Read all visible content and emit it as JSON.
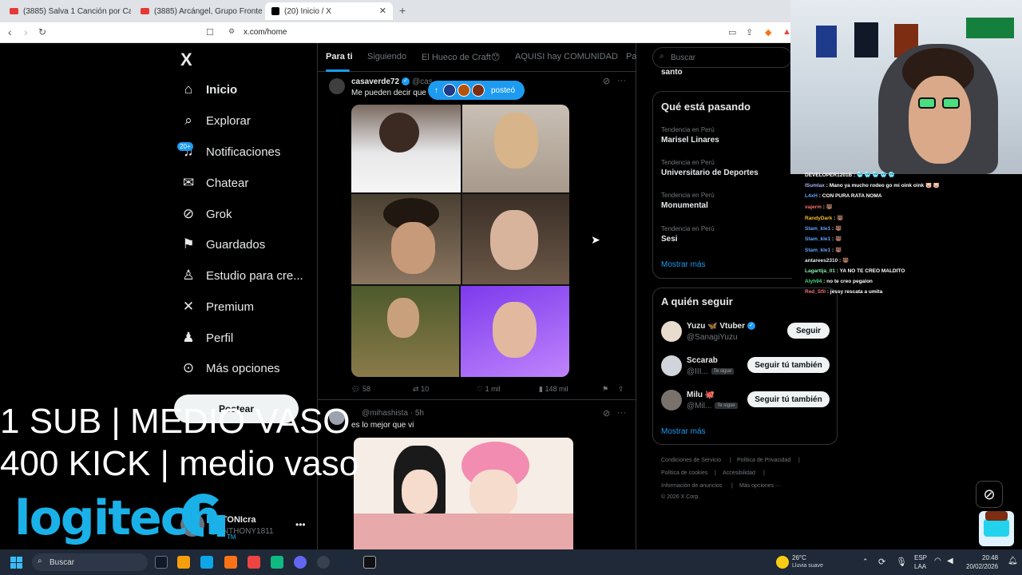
{
  "browser": {
    "tabs": [
      {
        "title": "(3885) Salva 1 Canción por Cada Cat..."
      },
      {
        "title": "(3885) Arcángel, Grupo Frontera"
      },
      {
        "title": "(20) Inicio / X"
      }
    ],
    "url": "x.com/home"
  },
  "sidebar": {
    "logo": "X",
    "items": [
      {
        "label": "Inicio",
        "icon": "home-icon"
      },
      {
        "label": "Explorar",
        "icon": "search-icon"
      },
      {
        "label": "Notificaciones",
        "icon": "bell-icon"
      },
      {
        "label": "Chatear",
        "icon": "mail-icon"
      },
      {
        "label": "Grok",
        "icon": "grok-icon"
      },
      {
        "label": "Guardados",
        "icon": "bookmark-icon"
      },
      {
        "label": "Estudio para cre...",
        "icon": "studio-icon"
      },
      {
        "label": "Premium",
        "icon": "x-premium-icon"
      },
      {
        "label": "Perfil",
        "icon": "person-icon"
      },
      {
        "label": "Más opciones",
        "icon": "more-circle-icon"
      }
    ],
    "notif_badge": "20+",
    "post_label": "Postear",
    "account": {
      "name": "ANTONIcra",
      "handle": "@ANTHONY1811"
    }
  },
  "overlay": {
    "line1": "1 SUB | MEDIO VASO",
    "line2": "400 KICK | medio vaso",
    "logi": "logitech",
    "tm": "TM"
  },
  "feed": {
    "tabs": [
      "Para ti",
      "Siguiendo",
      "El Hueco de Craft😯",
      "AQUISI hay COMUNIDAD",
      "Pa"
    ],
    "posted_pill": "posteó",
    "tweet1": {
      "name": "casaverde72",
      "handle": "@cas",
      "text": "Me pueden decir que",
      "replies": "58",
      "retweets": "10",
      "likes": "1 mil",
      "views": "148 mil"
    },
    "tweet2": {
      "handle": "@mihashista · 5h",
      "text": "es lo mejor que vi"
    }
  },
  "right": {
    "search_placeholder": "Buscar",
    "top_partial": "santo",
    "trends_title": "Qué está pasando",
    "trends": [
      {
        "context": "Tendencia en Perú",
        "name": "Marisel Linares"
      },
      {
        "context": "Tendencia en Perú",
        "name": "Universitario de Deportes"
      },
      {
        "context": "Tendencia en Perú",
        "name": "Monumental"
      },
      {
        "context": "Tendencia en Perú",
        "name": "Sesi"
      }
    ],
    "show_more": "Mostrar más",
    "follow_title": "A quién seguir",
    "follows": [
      {
        "name": "Yuzu 🦋 Vtuber",
        "handle": "@SanagiYuzu",
        "follows_you": "",
        "button": "Seguir"
      },
      {
        "name": "Sccarab",
        "handle": "@III...",
        "follows_you": "Te sigue",
        "button": "Seguir tú también"
      },
      {
        "name": "Milu 🐙",
        "handle": "@Mil...",
        "follows_you": "Te sigue",
        "button": "Seguir tú también"
      }
    ],
    "follow_more": "Mostrar más",
    "footer": [
      "Condiciones de Servicio",
      "|",
      "Política de Privacidad",
      "|",
      "Política de cookies",
      "|",
      "Accesibilidad",
      "|",
      "Información de anuncios",
      "|",
      "Más opciones ···",
      "© 2026 X Corp."
    ]
  },
  "chat": [
    {
      "user": "DEVELOPER1201B",
      "msg": ": 🥶 🥶 🥶 🥶 🥶",
      "color": "#ffffff"
    },
    {
      "user": "ISumlax",
      "msg": ": Mano ya mucho rodeo go mi oink oink 🐷 🐷",
      "color": "#a5b4fc"
    },
    {
      "user": "L4xH",
      "msg": ": CON PURA RATA NOMA",
      "color": "#60a5fa"
    },
    {
      "user": "vajerm",
      "msg": ": 🐻",
      "color": "#f87171"
    },
    {
      "user": "RandyDark",
      "msg": ": 🐻",
      "color": "#fbbf24"
    },
    {
      "user": "Stam_kle1",
      "msg": ": 🐻",
      "color": "#60a5fa"
    },
    {
      "user": "Stam_kle1",
      "msg": ": 🐻",
      "color": "#60a5fa"
    },
    {
      "user": "Stam_kle1",
      "msg": ": 🐻",
      "color": "#60a5fa"
    },
    {
      "user": "antarees2310",
      "msg": ": 🐻",
      "color": "#e5e7eb"
    },
    {
      "user": "Lagartija_01",
      "msg": ": YA NO TE CREO MALDITO",
      "color": "#86efac"
    },
    {
      "user": "Alyh94",
      "msg": ": no te creo pegalon",
      "color": "#4ade80"
    },
    {
      "user": "Red_Sfil",
      "msg": ": jessy rescata a umita",
      "color": "#f87171"
    }
  ],
  "taskbar": {
    "search": "Buscar",
    "weather_temp": "26°C",
    "weather_desc": "Lluvia suave",
    "lang1": "ESP",
    "lang2": "LAA",
    "time": "20:48",
    "date": "20/02/2026"
  },
  "colors": {
    "accent": "#1d9bf0",
    "logitech": "#1ab1e8"
  }
}
